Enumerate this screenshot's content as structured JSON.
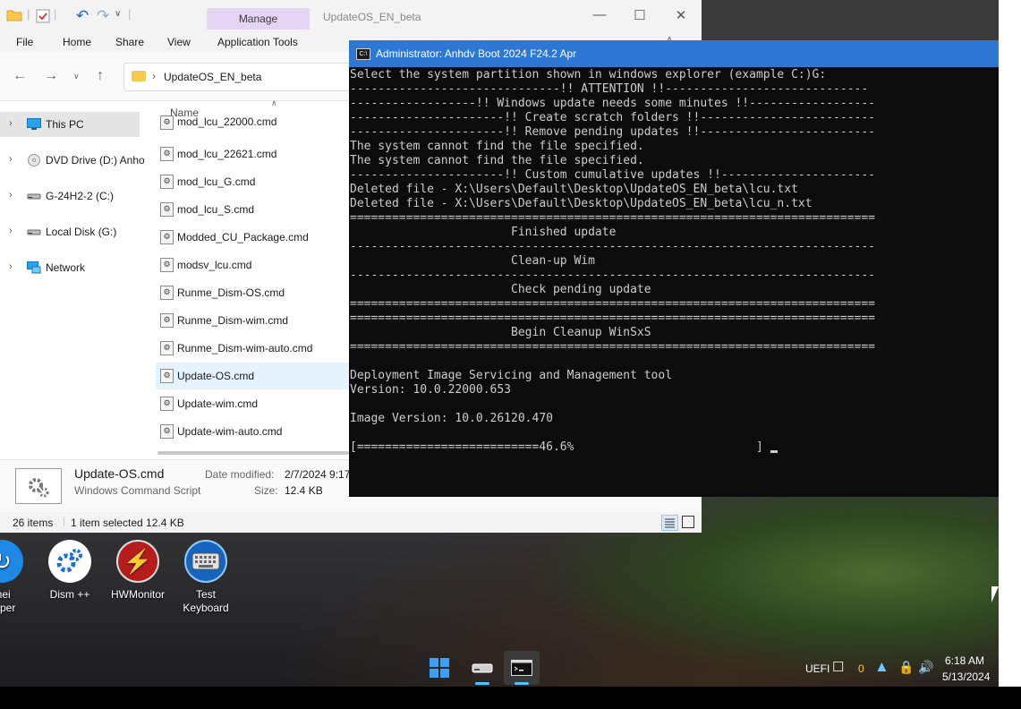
{
  "explorer": {
    "quick_access_icons": [
      "folder-icon",
      "check-icon",
      "undo-icon",
      "redo-icon",
      "chevron-down-icon"
    ],
    "manage_tab": "Manage",
    "window_title": "UpdateOS_EN_beta",
    "menu": [
      "File",
      "Home",
      "Share",
      "View",
      "Application Tools"
    ],
    "address": "UpdateOS_EN_beta",
    "sidebar": [
      {
        "label": "This PC",
        "icon": "monitor-icon",
        "selected": true
      },
      {
        "label": "DVD Drive (D:) Anho",
        "icon": "dvd-icon"
      },
      {
        "label": "G-24H2-2 (C:)",
        "icon": "drive-icon"
      },
      {
        "label": "Local Disk (G:)",
        "icon": "drive-icon"
      },
      {
        "label": "Network",
        "icon": "network-icon"
      }
    ],
    "column_header": "Name",
    "files": [
      {
        "name": "mod_lcu_22000.cmd"
      },
      {
        "name": "mod_lcu_22621.cmd"
      },
      {
        "name": "mod_lcu_G.cmd"
      },
      {
        "name": "mod_lcu_S.cmd"
      },
      {
        "name": "Modded_CU_Package.cmd"
      },
      {
        "name": "modsv_lcu.cmd"
      },
      {
        "name": "Runme_Dism-OS.cmd"
      },
      {
        "name": "Runme_Dism-wim.cmd"
      },
      {
        "name": "Runme_Dism-wim-auto.cmd"
      },
      {
        "name": "Update-OS.cmd",
        "selected": true
      },
      {
        "name": "Update-wim.cmd"
      },
      {
        "name": "Update-wim-auto.cmd"
      }
    ],
    "details": {
      "filename": "Update-OS.cmd",
      "type": "Windows Command Script",
      "modified_label": "Date modified:",
      "modified_value": "2/7/2024 9:17",
      "size_label": "Size:",
      "size_value": "12.4 KB"
    },
    "status": {
      "items": "26 items",
      "selected": "1 item selected  12.4 KB"
    }
  },
  "cmd": {
    "title": "Administrator:  Anhdv Boot 2024 F24.2 Apr",
    "lines": [
      "Select the system partition shown in windows explorer (example C:)G:",
      "------------------------------!! ATTENTION !!-----------------------------",
      "------------------!! Windows update needs some minutes !!------------------",
      "----------------------!! Create scratch folders !!-------------------------",
      "----------------------!! Remove pending updates !!-------------------------",
      "The system cannot find the file specified.",
      "The system cannot find the file specified.",
      "----------------------!! Custom cumulative updates !!----------------------",
      "Deleted file - X:\\Users\\Default\\Desktop\\UpdateOS_EN_beta\\lcu.txt",
      "Deleted file - X:\\Users\\Default\\Desktop\\UpdateOS_EN_beta\\lcu_n.txt",
      "===========================================================================",
      "                       Finished update",
      "---------------------------------------------------------------------------",
      "                       Clean-up Wim",
      "---------------------------------------------------------------------------",
      "                       Check pending update",
      "===========================================================================",
      "===========================================================================",
      "                       Begin Cleanup WinSxS",
      "===========================================================================",
      "",
      "Deployment Image Servicing and Management tool",
      "Version: 10.0.22000.653",
      "",
      "Image Version: 10.0.26120.470",
      "",
      "[==========================46.6%                          ] "
    ]
  },
  "desktop_icons": [
    {
      "label": "mei\nupper",
      "icon": "sync-icon",
      "color": "#1e88e5"
    },
    {
      "label": "Dism ++",
      "icon": "gears-icon",
      "color": "#1e6fd0"
    },
    {
      "label": "HWMonitor",
      "icon": "bolt-icon",
      "color": "#b71c1c"
    },
    {
      "label": "Test\nKeyboard",
      "icon": "keyboard-icon",
      "color": "#1565c0"
    }
  ],
  "taskbar": {
    "uefi": "UEFI",
    "badge": "0",
    "time": "6:18 AM",
    "date": "5/13/2024"
  }
}
